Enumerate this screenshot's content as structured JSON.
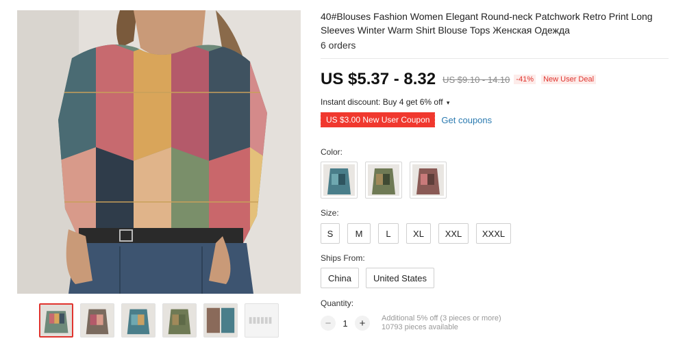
{
  "product": {
    "title": "40#Blouses Fashion Women Elegant Round-neck Patchwork Retro Print Long Sleeves Winter Warm Shirt Blouse Tops Женская Одежда",
    "orders": "6 orders"
  },
  "pricing": {
    "price": "US $5.37 - 8.32",
    "original_price": "US $9.10 - 14.10",
    "discount": "-41%",
    "new_user_deal": "New User Deal",
    "instant_discount": "Instant discount: Buy 4 get 6% off",
    "coupon": "US $3.00 New User Coupon",
    "get_coupons": "Get coupons"
  },
  "options": {
    "color_label": "Color:",
    "colors": [
      "blue-teal print",
      "olive-green print",
      "rose-brown print"
    ],
    "size_label": "Size:",
    "sizes": [
      "S",
      "M",
      "L",
      "XL",
      "XXL",
      "XXXL"
    ],
    "ships_label": "Ships From:",
    "ships_from": [
      "China",
      "United States"
    ]
  },
  "quantity": {
    "label": "Quantity:",
    "value": "1",
    "minus": "−",
    "plus": "+",
    "additional": "Additional 5% off (3 pieces or more)",
    "available": "10793 pieces available"
  },
  "colors": {
    "price_red": "#e0332d",
    "coupon_red": "#f0382e",
    "link_blue": "#2a7ab0"
  },
  "icons": {
    "chevron": "chevron-down-icon"
  }
}
